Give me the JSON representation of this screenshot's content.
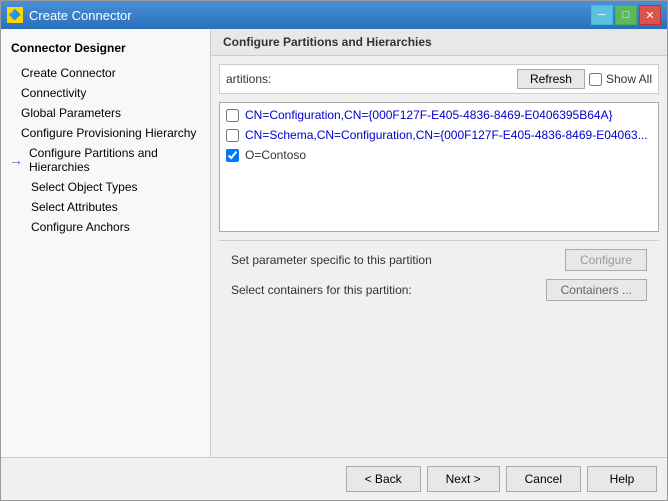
{
  "window": {
    "title": "Create Connector",
    "close_label": "✕",
    "icon": "🔷"
  },
  "sidebar": {
    "header": "Connector Designer",
    "items": [
      {
        "id": "create-connector",
        "label": "Create Connector",
        "indent": 1,
        "active": false,
        "current": false
      },
      {
        "id": "connectivity",
        "label": "Connectivity",
        "indent": 1,
        "active": false,
        "current": false
      },
      {
        "id": "global-parameters",
        "label": "Global Parameters",
        "indent": 1,
        "active": false,
        "current": false
      },
      {
        "id": "configure-provisioning",
        "label": "Configure Provisioning Hierarchy",
        "indent": 1,
        "active": false,
        "current": false
      },
      {
        "id": "configure-partitions",
        "label": "Configure Partitions and Hierarchies",
        "indent": 1,
        "active": true,
        "current": true
      },
      {
        "id": "select-object-types",
        "label": "Select Object Types",
        "indent": 2,
        "active": false,
        "current": false
      },
      {
        "id": "select-attributes",
        "label": "Select Attributes",
        "indent": 2,
        "active": false,
        "current": false
      },
      {
        "id": "configure-anchors",
        "label": "Configure Anchors",
        "indent": 2,
        "active": false,
        "current": false
      }
    ]
  },
  "main": {
    "header": "Configure Partitions and Hierarchies",
    "partitions_label": "artitions:",
    "refresh_btn": "Refresh",
    "show_all_label": "Show All",
    "partitions": [
      {
        "id": "p1",
        "checked": false,
        "text": "CN=Configuration,CN={000F127F-E405-4836-8469-E0406395B64A}",
        "is_link": true
      },
      {
        "id": "p2",
        "checked": false,
        "text": "CN=Schema,CN=Configuration,CN={000F127F-E405-4836-8469-E04063...",
        "is_link": true
      },
      {
        "id": "p3",
        "checked": true,
        "text": "O=Contoso",
        "is_link": false
      }
    ],
    "param_label": "Set parameter specific to this partition",
    "configure_btn": "Configure",
    "containers_label": "Select containers for this partition:",
    "containers_btn": "Containers ..."
  },
  "footer": {
    "back_btn": "< Back",
    "next_btn": "Next >",
    "cancel_btn": "Cancel",
    "help_btn": "Help"
  }
}
